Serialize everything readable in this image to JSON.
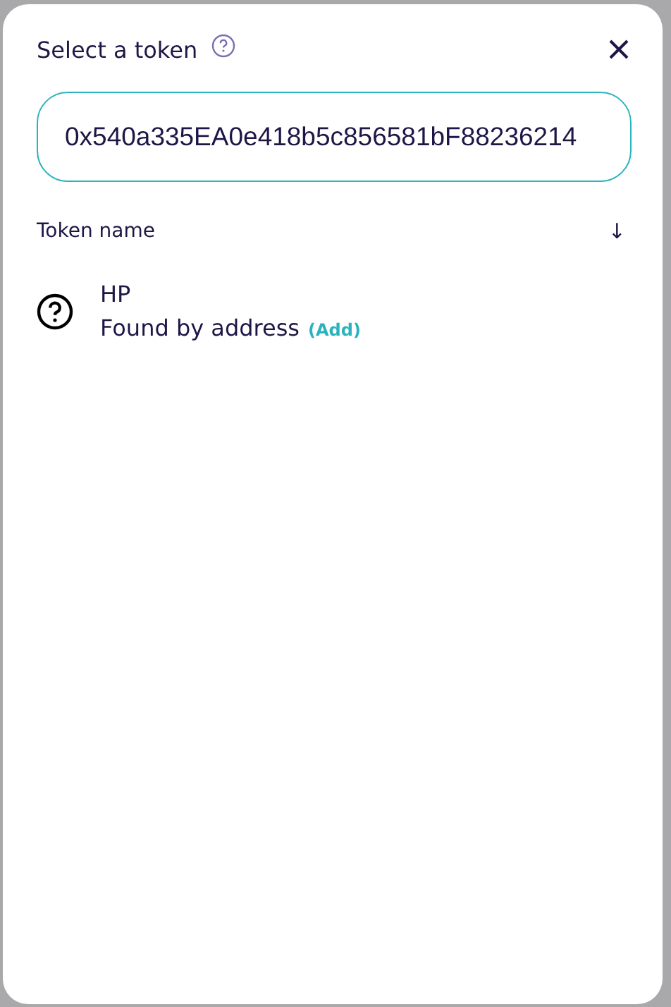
{
  "dialog": {
    "title": "Select a token",
    "search": {
      "value": "0x540a335EA0e418b5c856581bF88236214"
    },
    "list_header": {
      "label": "Token name",
      "sort": "↓"
    },
    "tokens": [
      {
        "symbol": "HP",
        "note": "Found by address",
        "action": "(Add)"
      }
    ]
  }
}
